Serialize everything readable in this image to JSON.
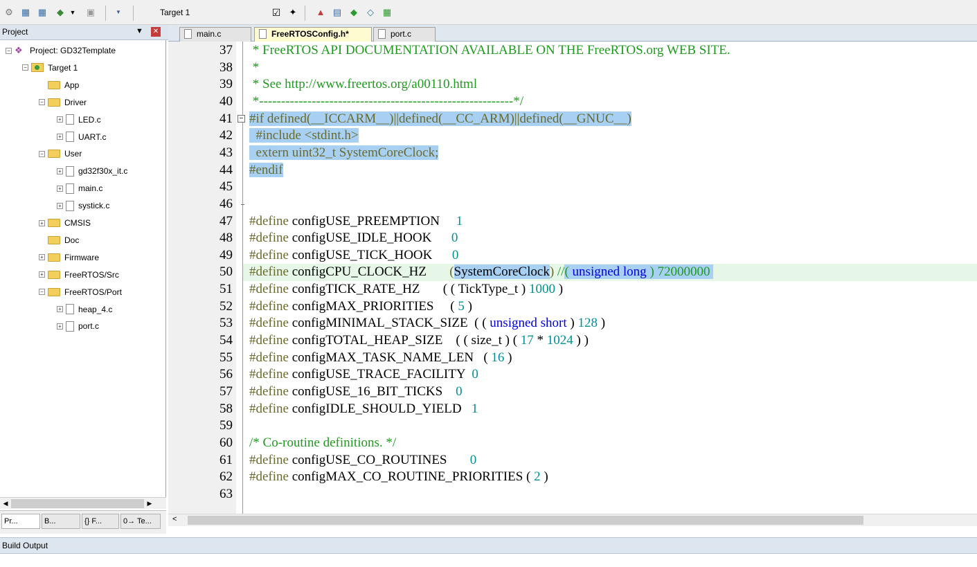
{
  "toolbar": {
    "target_select": "Target 1",
    "icons": [
      "settings-icon",
      "calc-icon",
      "calc-icon",
      "insert-icon",
      "dropdown-arrow-icon",
      "disk-icon",
      "load-icon",
      "checkbox-icon",
      "wand-icon",
      "build-icon",
      "rebuild-icon",
      "gem-green-icon",
      "gem-outline-icon",
      "stack-icon"
    ]
  },
  "project_panel": {
    "title": "Project",
    "pin_icon": "pin-icon",
    "close_icon": "close-icon",
    "tree": [
      {
        "label": "Project: GD32Template",
        "level": 0,
        "type": "project",
        "expander": "-"
      },
      {
        "label": "Target 1",
        "level": 1,
        "type": "target",
        "expander": "-"
      },
      {
        "label": "App",
        "level": 2,
        "type": "folder",
        "expander": ""
      },
      {
        "label": "Driver",
        "level": 2,
        "type": "folder",
        "expander": "-"
      },
      {
        "label": "LED.c",
        "level": 3,
        "type": "file",
        "expander": "+"
      },
      {
        "label": "UART.c",
        "level": 3,
        "type": "file",
        "expander": "+"
      },
      {
        "label": "User",
        "level": 2,
        "type": "folder",
        "expander": "-"
      },
      {
        "label": "gd32f30x_it.c",
        "level": 3,
        "type": "file",
        "expander": "+"
      },
      {
        "label": "main.c",
        "level": 3,
        "type": "file",
        "expander": "+"
      },
      {
        "label": "systick.c",
        "level": 3,
        "type": "file",
        "expander": "+"
      },
      {
        "label": "CMSIS",
        "level": 2,
        "type": "folder",
        "expander": "+"
      },
      {
        "label": "Doc",
        "level": 2,
        "type": "folder",
        "expander": ""
      },
      {
        "label": "Firmware",
        "level": 2,
        "type": "folder",
        "expander": "+"
      },
      {
        "label": "FreeRTOS/Src",
        "level": 2,
        "type": "folder",
        "expander": "+"
      },
      {
        "label": "FreeRTOS/Port",
        "level": 2,
        "type": "folder",
        "expander": "-"
      },
      {
        "label": "heap_4.c",
        "level": 3,
        "type": "file",
        "expander": "+"
      },
      {
        "label": "port.c",
        "level": 3,
        "type": "file",
        "expander": "+"
      }
    ],
    "bottom_tabs": [
      "Pr...",
      "B...",
      "{} F...",
      "0→ Te..."
    ]
  },
  "editor": {
    "tabs": [
      {
        "label": "main.c",
        "active": false
      },
      {
        "label": "FreeRTOSConfig.h*",
        "active": true
      },
      {
        "label": "port.c",
        "active": false
      }
    ],
    "lines": [
      {
        "n": "37",
        "tokens": [
          {
            "t": " * FreeRTOS API DOCUMENTATION AVAILABLE ON THE FreeRTOS.org WEB SITE.",
            "c": "com"
          }
        ]
      },
      {
        "n": "38",
        "tokens": [
          {
            "t": " *",
            "c": "com"
          }
        ]
      },
      {
        "n": "39",
        "tokens": [
          {
            "t": " * See http://www.freertos.org/a00110.html",
            "c": "com"
          }
        ]
      },
      {
        "n": "40",
        "tokens": [
          {
            "t": " *----------------------------------------------------------*/",
            "c": "com"
          }
        ]
      },
      {
        "n": "41",
        "fold": "-",
        "tokens": [
          {
            "t": "#if defined(__ICCARM__)||defined(__CC_ARM)||defined(__GNUC__)",
            "c": "pp",
            "sel": true
          }
        ]
      },
      {
        "n": "42",
        "tokens": [
          {
            "t": "  #include <stdint.h>",
            "c": "pp",
            "sel": true
          }
        ]
      },
      {
        "n": "43",
        "tokens": [
          {
            "t": "  extern uint32_t SystemCoreClock;",
            "c": "pp",
            "sel": true
          }
        ]
      },
      {
        "n": "44",
        "tokens": [
          {
            "t": "#endif",
            "c": "pp",
            "sel": true
          }
        ]
      },
      {
        "n": "45",
        "tokens": []
      },
      {
        "n": "46",
        "tick": true,
        "tokens": []
      },
      {
        "n": "47",
        "tokens": [
          {
            "t": "#define ",
            "c": "pp"
          },
          {
            "t": "configUSE_PREEMPTION     ",
            "c": "def"
          },
          {
            "t": "1",
            "c": "num"
          }
        ]
      },
      {
        "n": "48",
        "tokens": [
          {
            "t": "#define ",
            "c": "pp"
          },
          {
            "t": "configUSE_IDLE_HOOK      ",
            "c": "def"
          },
          {
            "t": "0",
            "c": "num"
          }
        ]
      },
      {
        "n": "49",
        "tokens": [
          {
            "t": "#define ",
            "c": "pp"
          },
          {
            "t": "configUSE_TICK_HOOK      ",
            "c": "def"
          },
          {
            "t": "0",
            "c": "num"
          }
        ]
      },
      {
        "n": "50",
        "row": true,
        "tokens": [
          {
            "t": "#define ",
            "c": "pp"
          },
          {
            "t": "configCPU_CLOCK_HZ       ",
            "c": "def"
          },
          {
            "t": "(",
            "c": "pp"
          },
          {
            "t": "SystemCoreClock",
            "c": "def",
            "sel": true
          },
          {
            "t": ") ",
            "c": "pp"
          },
          {
            "t": "//",
            "c": "com"
          },
          {
            "t": "( ",
            "c": "com",
            "sel": true
          },
          {
            "t": "unsigned long",
            "c": "kw",
            "sel": true
          },
          {
            "t": " ) 72000000 ",
            "c": "com",
            "sel": true
          }
        ]
      },
      {
        "n": "51",
        "tokens": [
          {
            "t": "#define ",
            "c": "pp"
          },
          {
            "t": "configTICK_RATE_HZ       ",
            "c": "def"
          },
          {
            "t": "( ( TickType_t ) ",
            "c": "def"
          },
          {
            "t": "1000",
            "c": "num"
          },
          {
            "t": " )",
            "c": "def"
          }
        ]
      },
      {
        "n": "52",
        "tokens": [
          {
            "t": "#define ",
            "c": "pp"
          },
          {
            "t": "configMAX_PRIORITIES     ",
            "c": "def"
          },
          {
            "t": "( ",
            "c": "def"
          },
          {
            "t": "5",
            "c": "num"
          },
          {
            "t": " )",
            "c": "def"
          }
        ]
      },
      {
        "n": "53",
        "tokens": [
          {
            "t": "#define ",
            "c": "pp"
          },
          {
            "t": "configMINIMAL_STACK_SIZE  ",
            "c": "def"
          },
          {
            "t": "( ( ",
            "c": "def"
          },
          {
            "t": "unsigned short",
            "c": "kw"
          },
          {
            "t": " ) ",
            "c": "def"
          },
          {
            "t": "128",
            "c": "num"
          },
          {
            "t": " )",
            "c": "def"
          }
        ]
      },
      {
        "n": "54",
        "tokens": [
          {
            "t": "#define ",
            "c": "pp"
          },
          {
            "t": "configTOTAL_HEAP_SIZE    ",
            "c": "def"
          },
          {
            "t": "( ( size_t ) ( ",
            "c": "def"
          },
          {
            "t": "17",
            "c": "num"
          },
          {
            "t": " * ",
            "c": "def"
          },
          {
            "t": "1024",
            "c": "num"
          },
          {
            "t": " ) )",
            "c": "def"
          }
        ]
      },
      {
        "n": "55",
        "tokens": [
          {
            "t": "#define ",
            "c": "pp"
          },
          {
            "t": "configMAX_TASK_NAME_LEN   ",
            "c": "def"
          },
          {
            "t": "( ",
            "c": "def"
          },
          {
            "t": "16",
            "c": "num"
          },
          {
            "t": " )",
            "c": "def"
          }
        ]
      },
      {
        "n": "56",
        "tokens": [
          {
            "t": "#define ",
            "c": "pp"
          },
          {
            "t": "configUSE_TRACE_FACILITY  ",
            "c": "def"
          },
          {
            "t": "0",
            "c": "num"
          }
        ]
      },
      {
        "n": "57",
        "tokens": [
          {
            "t": "#define ",
            "c": "pp"
          },
          {
            "t": "configUSE_16_BIT_TICKS    ",
            "c": "def"
          },
          {
            "t": "0",
            "c": "num"
          }
        ]
      },
      {
        "n": "58",
        "tokens": [
          {
            "t": "#define ",
            "c": "pp"
          },
          {
            "t": "configIDLE_SHOULD_YIELD   ",
            "c": "def"
          },
          {
            "t": "1",
            "c": "num"
          }
        ]
      },
      {
        "n": "59",
        "tokens": []
      },
      {
        "n": "60",
        "tokens": [
          {
            "t": "/* Co-routine definitions. */",
            "c": "com"
          }
        ]
      },
      {
        "n": "61",
        "tokens": [
          {
            "t": "#define ",
            "c": "pp"
          },
          {
            "t": "configUSE_CO_ROUTINES       ",
            "c": "def"
          },
          {
            "t": "0",
            "c": "num"
          }
        ]
      },
      {
        "n": "62",
        "tokens": [
          {
            "t": "#define ",
            "c": "pp"
          },
          {
            "t": "configMAX_CO_ROUTINE_PRIORITIES ( ",
            "c": "def"
          },
          {
            "t": "2",
            "c": "num"
          },
          {
            "t": " )",
            "c": "def"
          }
        ]
      },
      {
        "n": "63",
        "tokens": []
      }
    ]
  },
  "build_output": {
    "title": "Build Output"
  },
  "colors": {
    "comment": "#1f9a1f",
    "preprocessor": "#6a6a2e",
    "keyword": "#0000e0",
    "number": "#009090",
    "selection": "#a7d0f3",
    "current_line": "#e6f7e8",
    "active_tab": "#fffbd0"
  }
}
